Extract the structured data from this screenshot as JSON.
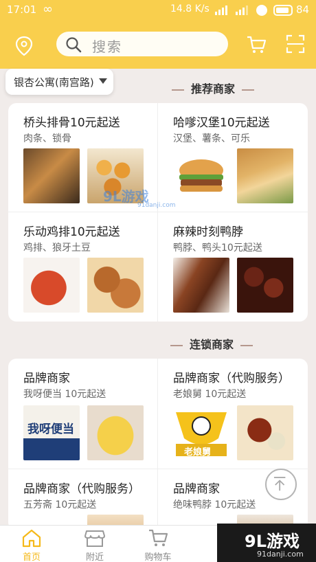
{
  "status_bar": {
    "time": "17:01",
    "loop_glyph": "∞",
    "network_speed": "14.8 K/s",
    "battery": "84"
  },
  "header": {
    "search_placeholder": "搜索"
  },
  "address": {
    "label": "银杏公寓(南宫路)"
  },
  "sections": {
    "recommended": {
      "title": "推荐商家",
      "merchants": [
        {
          "name": "桥头排骨10元起送",
          "subtitle": "肉条、锁骨",
          "images": [
            "food-brown",
            "food-golden"
          ]
        },
        {
          "name": "哈嗲汉堡10元起送",
          "subtitle": "汉堡、薯条、可乐",
          "images": [
            "food-burger",
            "food-wrap"
          ]
        },
        {
          "name": "乐动鸡排10元起送",
          "subtitle": "鸡排、狼牙土豆",
          "images": [
            "food-wings",
            "food-cutlet"
          ]
        },
        {
          "name": "麻辣时刻鸭脖",
          "subtitle": "鸭脖、鸭头10元起送",
          "images": [
            "food-duck",
            "food-duck2"
          ]
        }
      ]
    },
    "chain": {
      "title": "连锁商家",
      "merchants": [
        {
          "name": "品牌商家",
          "subtitle": "我呀便当 10元起送",
          "images": [
            "food-woya",
            "food-bento"
          ]
        },
        {
          "name": "品牌商家（代购服务）",
          "subtitle": "老娘舅 10元起送",
          "images": [
            "food-laoniang",
            "food-stew"
          ]
        },
        {
          "name": "品牌商家（代购服务）",
          "subtitle": "五芳斋 10元起送",
          "images": [
            "food-strip"
          ]
        },
        {
          "name": "品牌商家",
          "subtitle": "绝味鸭脖 10元起送",
          "images": [
            "food-strip2"
          ]
        }
      ]
    }
  },
  "image_text": {
    "woya": "我呀便当",
    "laoniang": "老娘舅"
  },
  "tabs": [
    {
      "label": "首页",
      "icon": "home-icon",
      "active": true
    },
    {
      "label": "附近",
      "icon": "store-icon",
      "active": false
    },
    {
      "label": "购物车",
      "icon": "cart-icon",
      "active": false
    }
  ],
  "watermark": {
    "brand": "9L游戏",
    "site": "91danji.com",
    "mid_brand": "9L游戏",
    "mid_site": "91danji.com"
  },
  "colors": {
    "header_bg": "#f9cf4d",
    "page_bg": "#f1ecea",
    "active_tab": "#f5b91a"
  }
}
